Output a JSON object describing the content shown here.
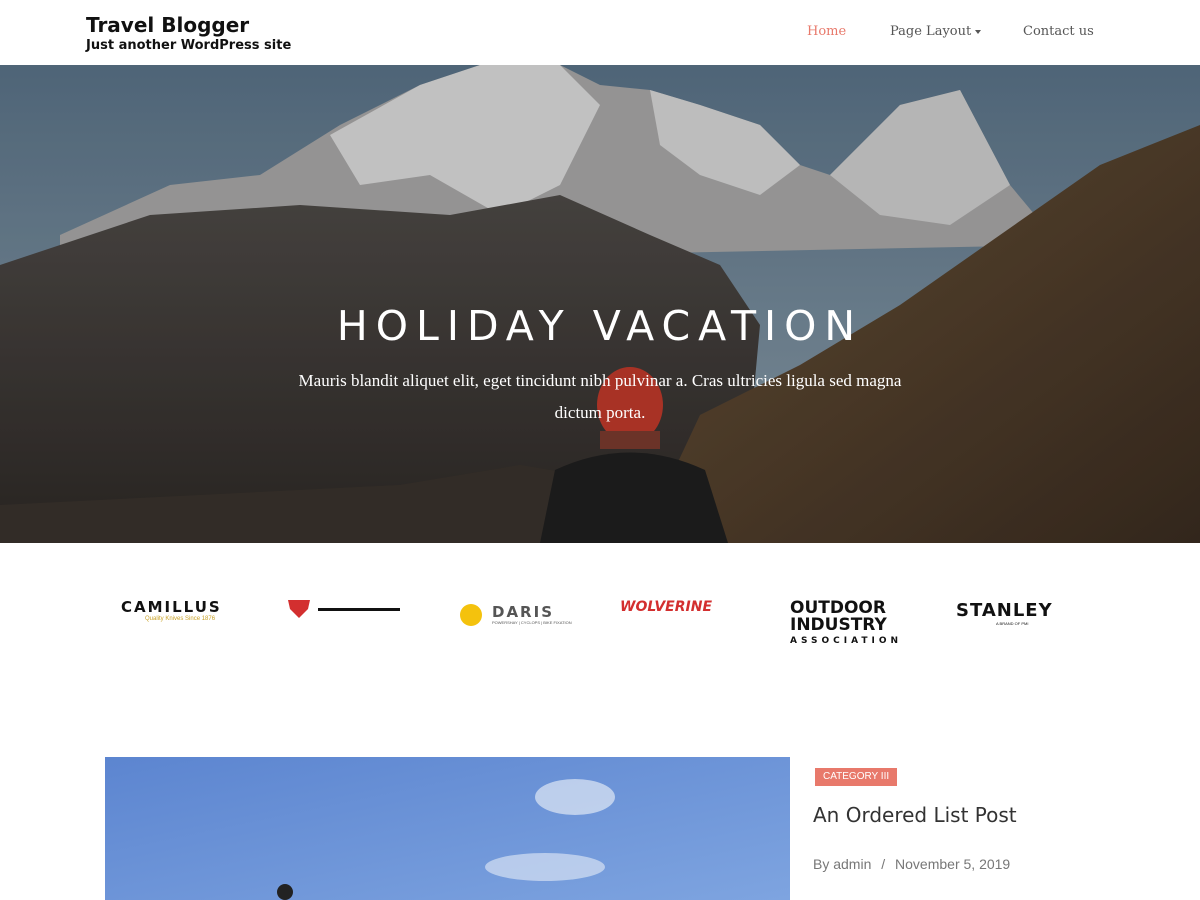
{
  "header": {
    "site_title": "Travel Blogger",
    "tagline": "Just another WordPress site",
    "nav": [
      {
        "label": "Home",
        "active": true
      },
      {
        "label": "Page Layout",
        "has_dropdown": true
      },
      {
        "label": "Contact us"
      }
    ]
  },
  "hero": {
    "title": "HOLIDAY VACATION",
    "text": "Mauris blandit aliquet elit, eget tincidunt nibh pulvinar a. Cras ultricies ligula sed magna dictum porta."
  },
  "logos": [
    {
      "name": "CAMILLUS",
      "sub": "Quality Knives Since 1876"
    },
    {
      "name": "mark-logo"
    },
    {
      "name": "DARIS",
      "sub": "POWERSHAY | CYCLOPS | BIKE FIXATION"
    },
    {
      "name": "WOLVERINE"
    },
    {
      "name": "OUTDOOR INDUSTRY",
      "sub": "ASSOCIATION"
    },
    {
      "name": "STANLEY",
      "sub": "A BRAND OF PMI"
    }
  ],
  "post": {
    "category": "CATEGORY III",
    "title": "An Ordered List Post",
    "author": "By admin",
    "separator": "/",
    "date": "November 5, 2019"
  },
  "colors": {
    "accent": "#e8796b",
    "text": "#333333"
  }
}
